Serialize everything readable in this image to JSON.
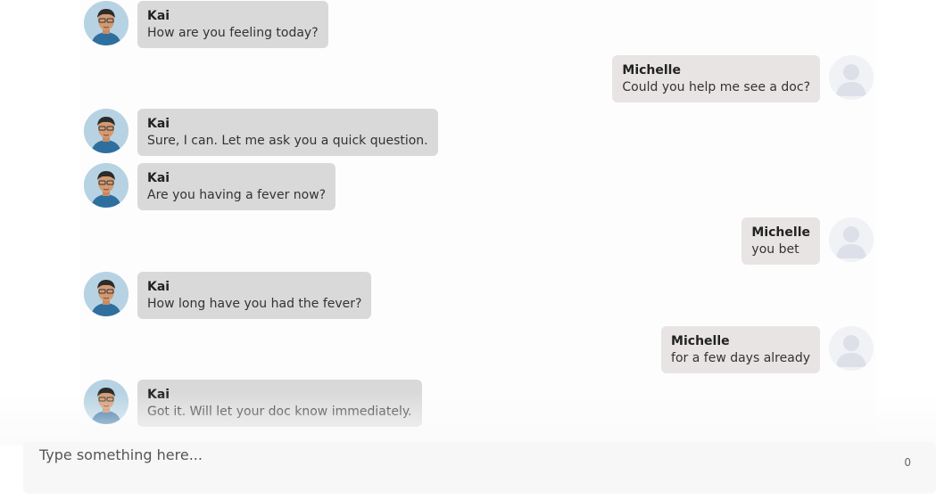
{
  "messages": [
    {
      "sender": "Kai",
      "text": "How are you feeling today?",
      "side": "bot"
    },
    {
      "sender": "Michelle",
      "text": "Could you help me see a doc?",
      "side": "user"
    },
    {
      "sender": "Kai",
      "text": "Sure, I can. Let me ask you a quick question.",
      "side": "bot"
    },
    {
      "sender": "Kai",
      "text": "Are you having a fever now?",
      "side": "bot"
    },
    {
      "sender": "Michelle",
      "text": "you bet",
      "side": "user"
    },
    {
      "sender": "Kai",
      "text": "How long have you had the fever?",
      "side": "bot"
    },
    {
      "sender": "Michelle",
      "text": "for a few days already",
      "side": "user"
    },
    {
      "sender": "Kai",
      "text": "Got it. Will let your doc know immediately.",
      "side": "bot"
    }
  ],
  "composer": {
    "placeholder": "Type something here...",
    "char_count": "0"
  },
  "colors": {
    "bot_bubble": "#d9d9d9",
    "user_bubble": "#e8e4e4"
  }
}
